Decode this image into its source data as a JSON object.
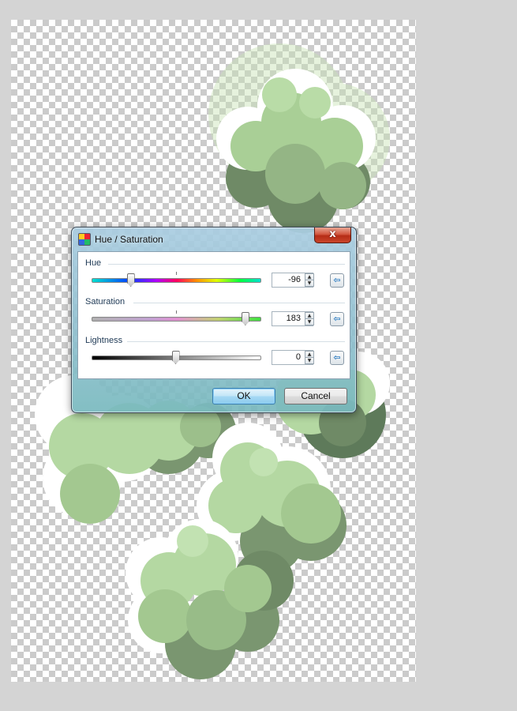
{
  "dialog": {
    "title": "Hue / Saturation",
    "close_label": "x",
    "ok_label": "OK",
    "cancel_label": "Cancel"
  },
  "hue": {
    "label": "Hue",
    "value": "-96",
    "range": [
      -180,
      180
    ]
  },
  "saturation": {
    "label": "Saturation",
    "value": "183",
    "range": [
      0,
      200
    ]
  },
  "lightness": {
    "label": "Lightness",
    "value": "0",
    "range": [
      -100,
      100
    ]
  },
  "icons": {
    "app": "hue-saturation-icon",
    "close": "close-icon",
    "reset": "reset-arrow-icon",
    "spin_up": "spin-up-icon",
    "spin_down": "spin-down-icon"
  },
  "colors": {
    "canvas_checker": "#cbcbcb",
    "cloud_light": "#b4d8a2",
    "cloud_dark": "#7a9670",
    "close_red": "#c9452a",
    "ok_blue": "#8ccbee"
  }
}
